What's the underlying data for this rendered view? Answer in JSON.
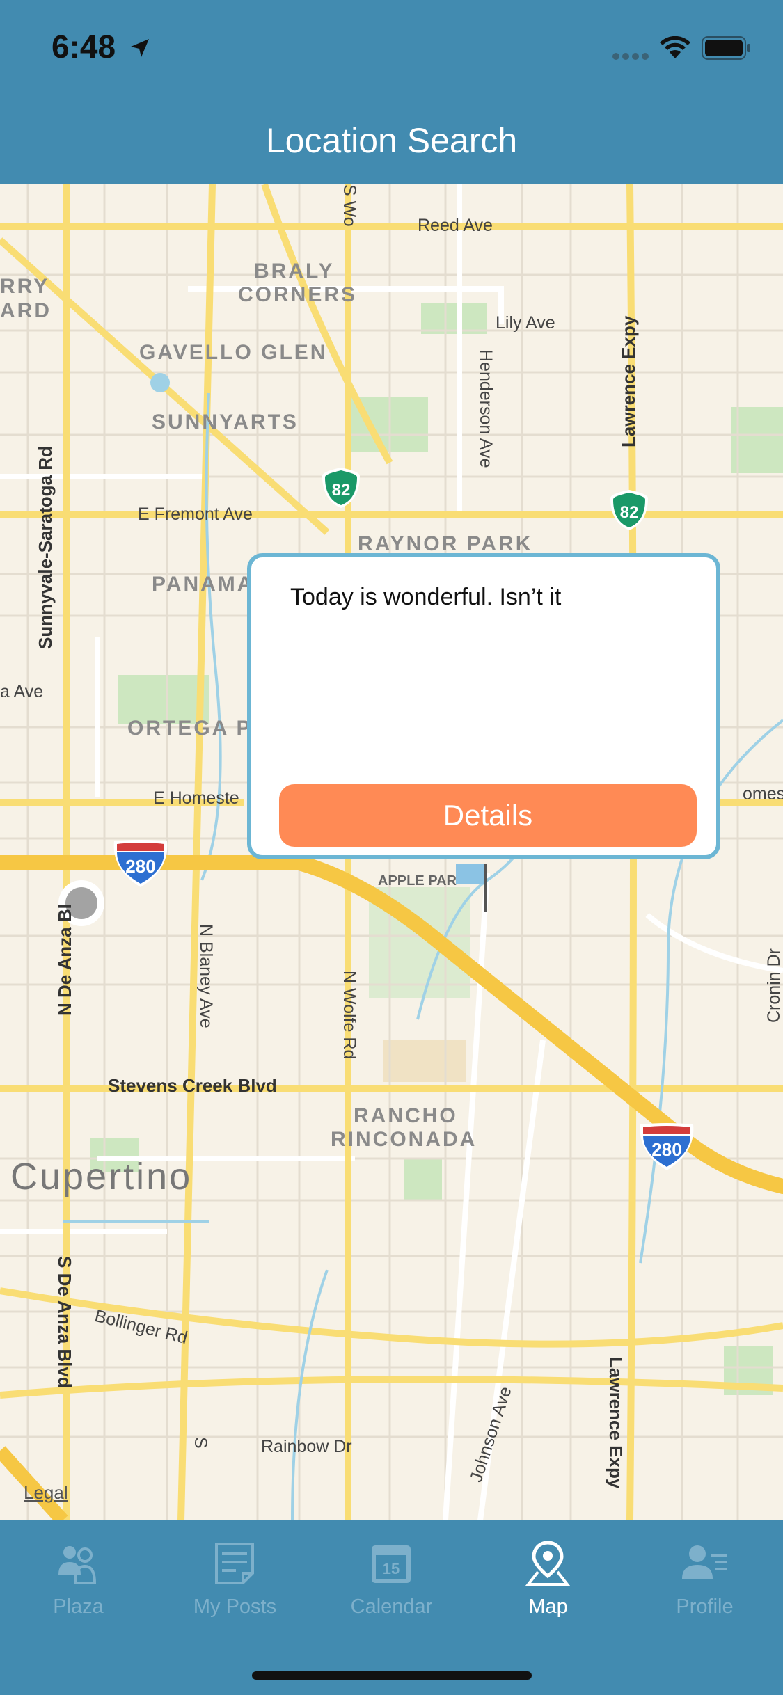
{
  "status": {
    "time": "6:48"
  },
  "nav": {
    "title": "Location Search"
  },
  "map": {
    "districts": [
      "BRALY",
      "CORNERS",
      "GAVELLO GLEN",
      "SUNNYARTS",
      "RAYNOR PARK",
      "PANAMA",
      "ORTEGA P",
      "RANCHO",
      "RINCONADA",
      "RRY",
      "ARD"
    ],
    "city": "Cupertino",
    "roads": {
      "reed": "Reed Ave",
      "lily": "Lily Ave",
      "fremont": "E Fremont Ave",
      "homestead_w": "E Homeste",
      "homestead_e": "omeste",
      "stevens": "Stevens Creek Blvd",
      "bollinger": "Bollinger Rd",
      "rainbow": "Rainbow Dr",
      "a_ave": "a Ave",
      "apple_park": "APPLE PAR",
      "sunnyvale_saratoga": "Sunnyvale-Saratoga Rd",
      "henderson": "Henderson Ave",
      "lawrence_n": "Lawrence Expy",
      "lawrence_s": "Lawrence Expy",
      "n_de_anza": "N De Anza Bl",
      "n_blaney": "N Blaney Ave",
      "n_wolfe": "N Wolfe Rd",
      "s_wolfe_top": "S Wo",
      "s_de_anza": "S De Anza Blvd",
      "johnson": "Johnson Ave",
      "cronin": "Cronin Dr",
      "s_bottom": "S"
    },
    "shields": {
      "sr82_a": "82",
      "sr82_b": "82",
      "i280_a": "280",
      "i280_b": "280"
    },
    "legal": "Legal"
  },
  "popup": {
    "text": "Today is wonderful. Isn’t it",
    "button_label": "Details"
  },
  "tabs": [
    {
      "label": "Plaza",
      "icon": "people-icon",
      "active": false
    },
    {
      "label": "My Posts",
      "icon": "posts-icon",
      "active": false
    },
    {
      "label": "Calendar",
      "icon": "calendar-icon",
      "active": false,
      "day": "15"
    },
    {
      "label": "Map",
      "icon": "map-pin-icon",
      "active": true
    },
    {
      "label": "Profile",
      "icon": "profile-icon",
      "active": false
    }
  ],
  "colors": {
    "bar": "#428bb0",
    "accent": "#ff8a55",
    "popup_border": "#6cb6d4",
    "tab_inactive": "#7db0cb"
  }
}
